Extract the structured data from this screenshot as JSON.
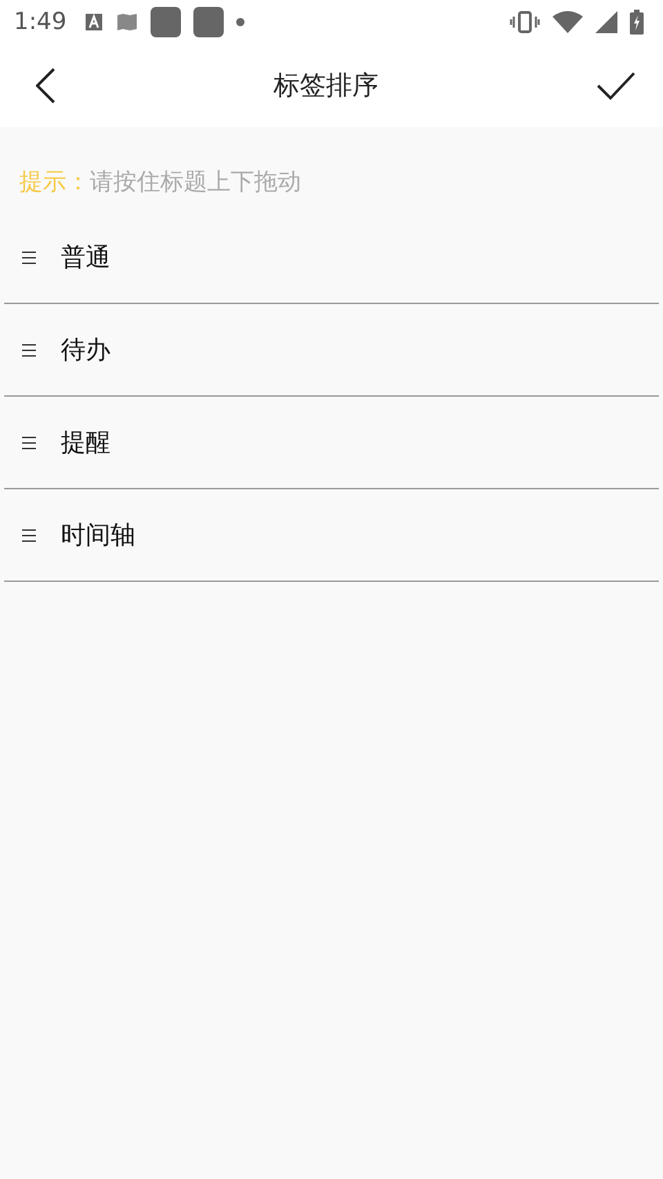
{
  "status_bar": {
    "time": "1:49"
  },
  "header": {
    "title": "标签排序"
  },
  "hint": {
    "label": "提示：",
    "text": "请按住标题上下拖动"
  },
  "items": [
    {
      "label": "普通"
    },
    {
      "label": "待办"
    },
    {
      "label": "提醒"
    },
    {
      "label": "时间轴"
    }
  ]
}
